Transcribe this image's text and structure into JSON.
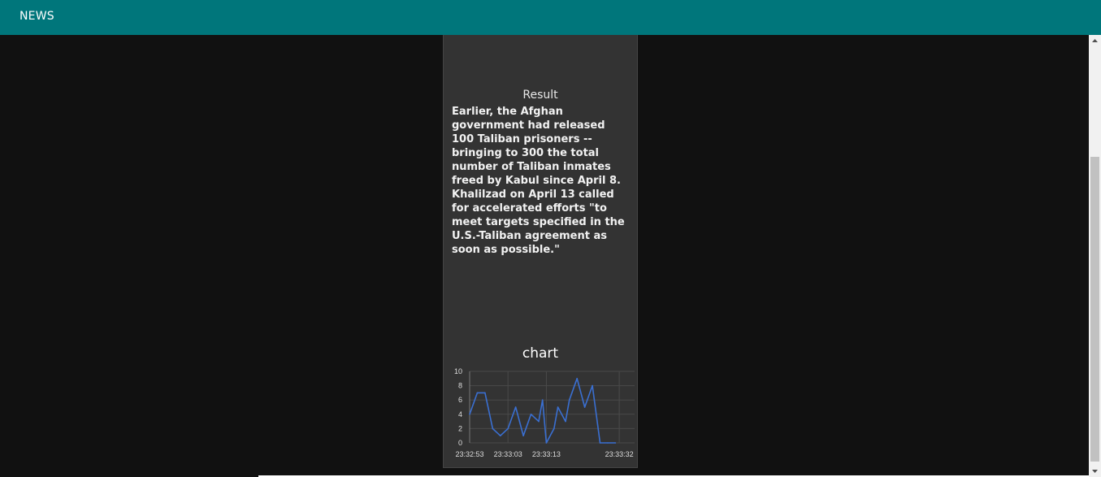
{
  "header": {
    "title": "NEWS",
    "bg_color": "#00767b"
  },
  "card": {
    "result_label": "Result",
    "result_text": "Earlier, the Afghan government had released 100 Taliban prisoners -- bringing to 300 the total number of Taliban inmates freed by Kabul since April 8. Khalilzad on April 13 called for accelerated efforts \"to meet targets specified in the U.S.-Taliban agreement as soon as possible.\"",
    "chart_title": "chart"
  },
  "icons": {
    "scroll_up": "chevron-up-icon",
    "scroll_down": "chevron-down-icon"
  },
  "chart_data": {
    "type": "line",
    "title": "chart",
    "xlabel": "",
    "ylabel": "",
    "ylim": [
      0,
      10
    ],
    "yticks": [
      0,
      2,
      4,
      6,
      8,
      10
    ],
    "xtick_labels": [
      "23:32:53",
      "23:33:03",
      "23:33:13",
      "23:33:32"
    ],
    "xtick_seconds": [
      0,
      10,
      20,
      39
    ],
    "xlim_seconds": [
      0,
      43
    ],
    "grid": true,
    "line_color": "#3a6fd1",
    "series": [
      {
        "x_seconds": [
          0,
          2,
          4,
          6,
          8,
          10,
          12,
          14,
          16,
          18,
          19,
          20,
          22,
          23,
          25,
          26,
          28,
          30,
          32,
          34,
          36,
          38
        ],
        "values": [
          4,
          7,
          7,
          2,
          1,
          2,
          5,
          1,
          4,
          3,
          6,
          0,
          2,
          5,
          3,
          6,
          9,
          5,
          8,
          0,
          0,
          0
        ]
      }
    ]
  }
}
